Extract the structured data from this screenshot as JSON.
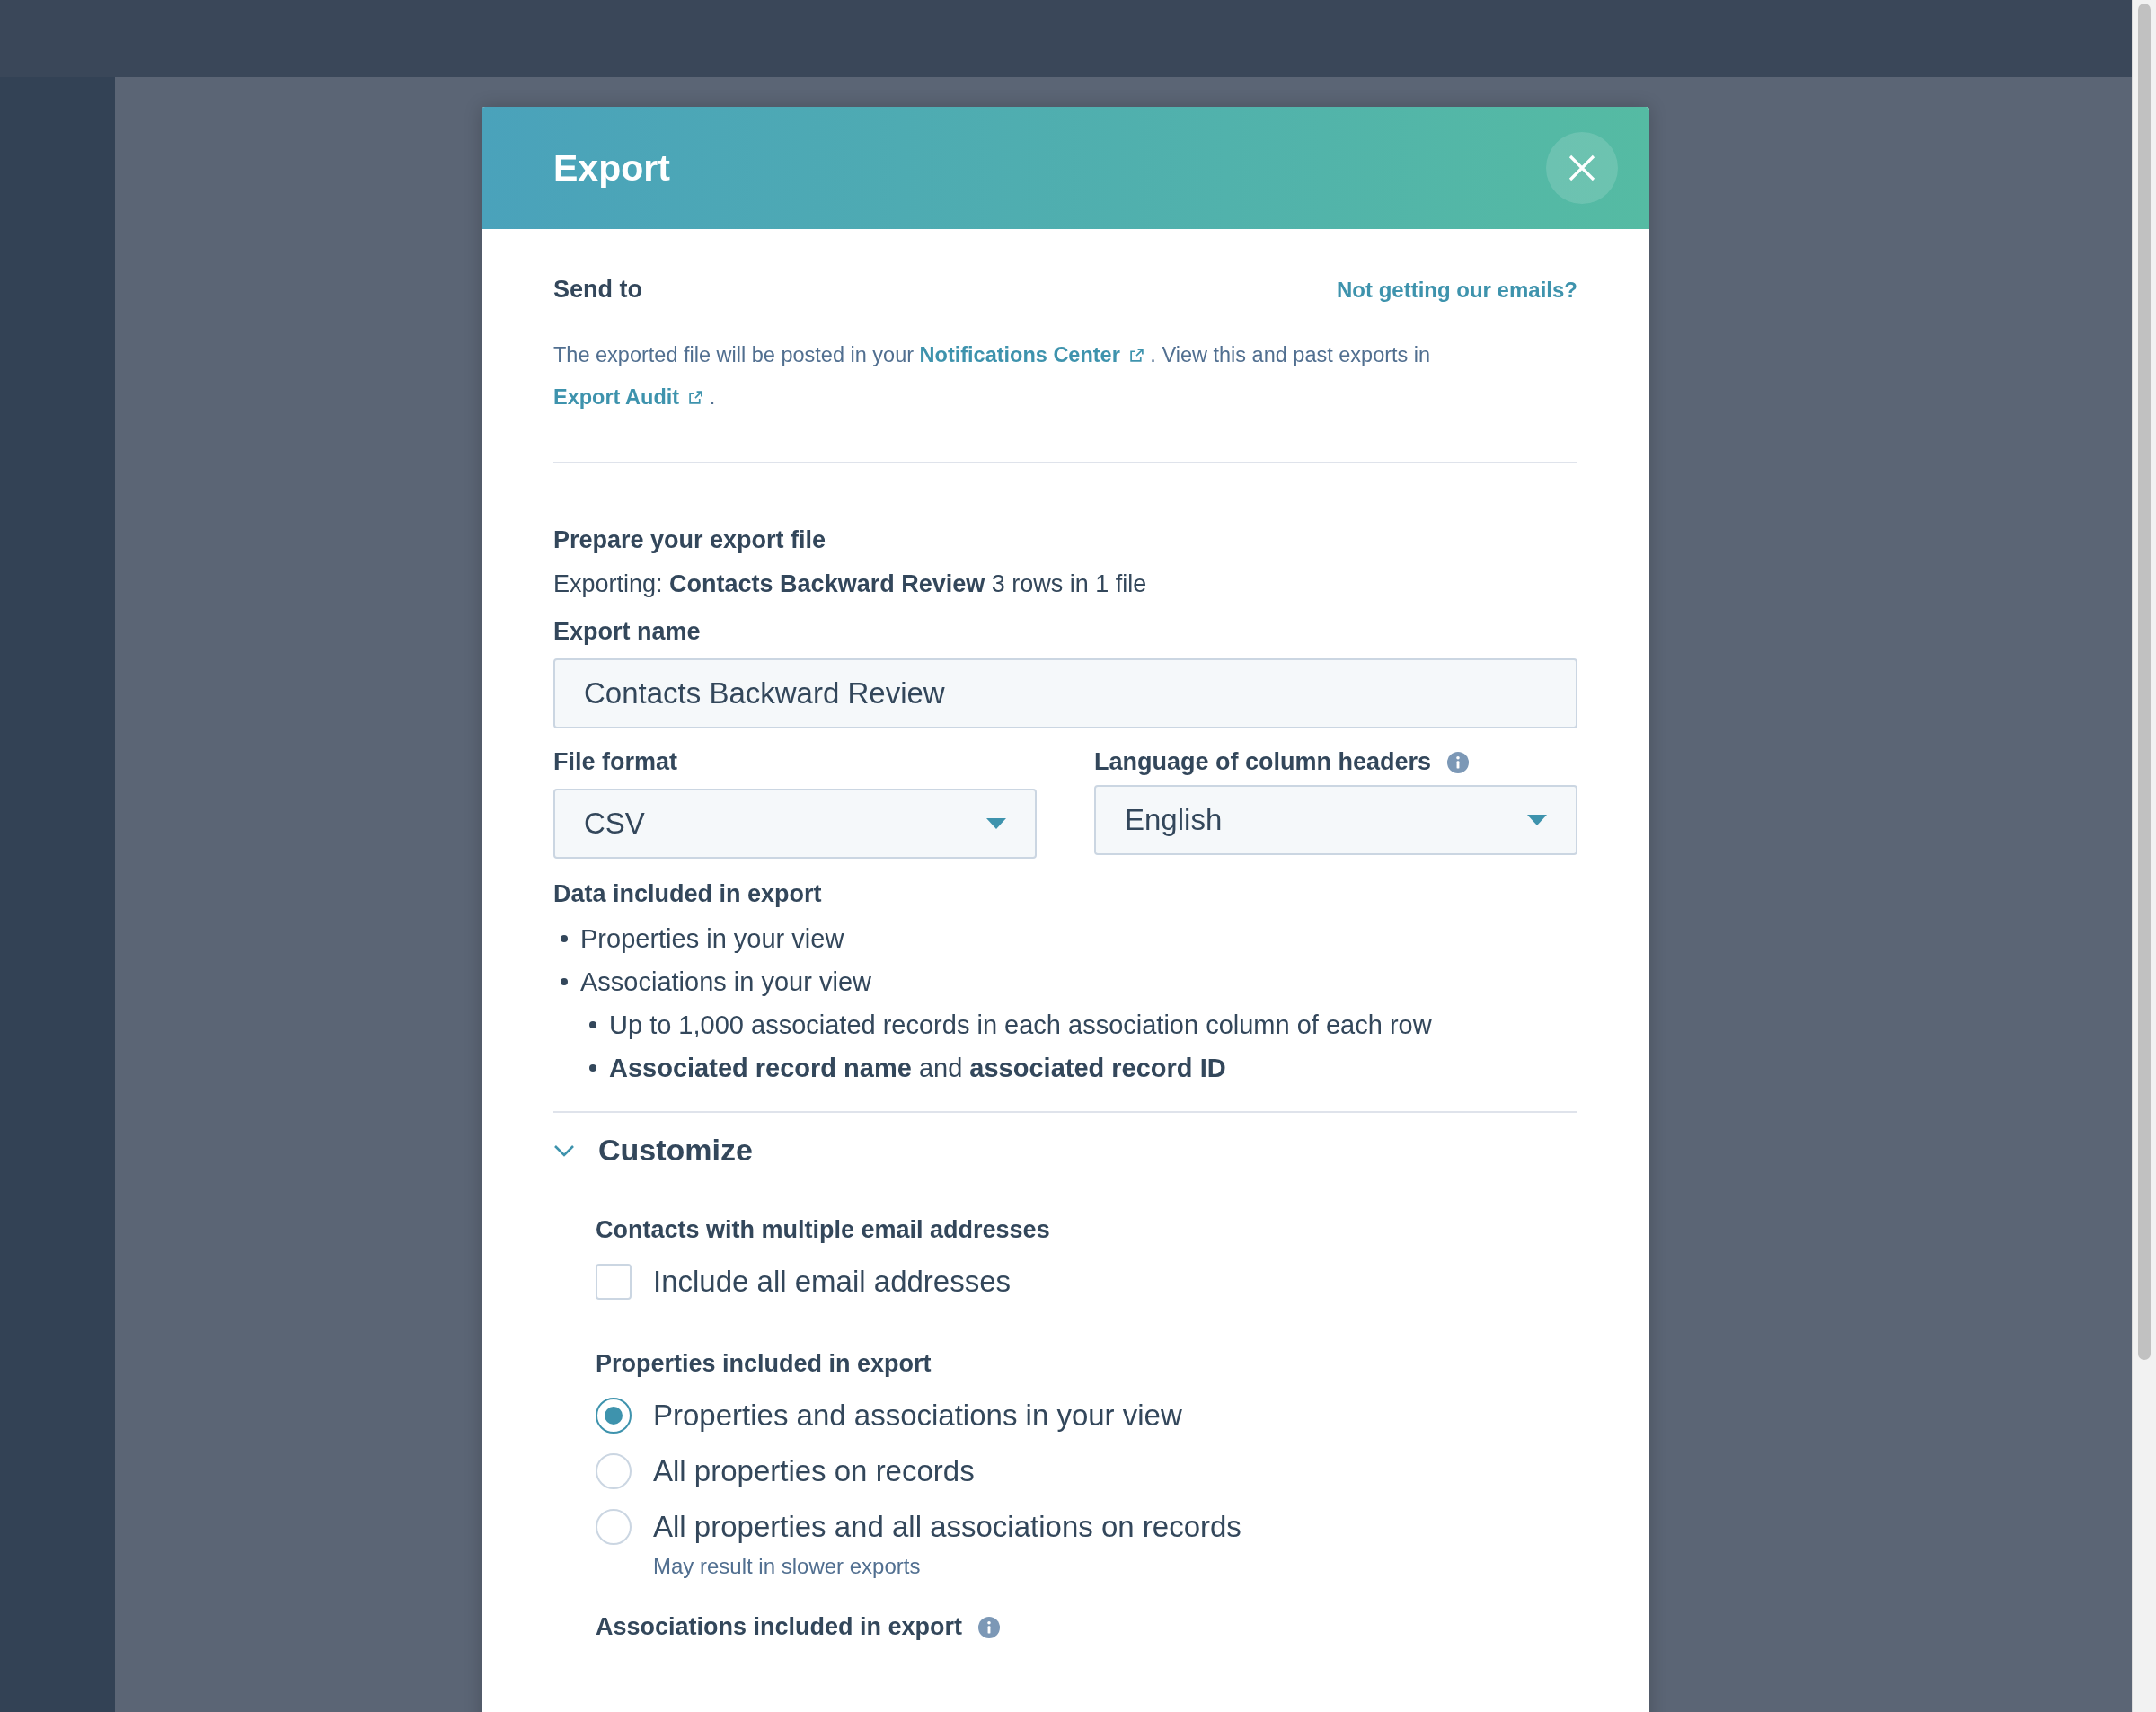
{
  "modal": {
    "title": "Export"
  },
  "send_to": {
    "heading": "Send to",
    "help_link": "Not getting our emails?",
    "description": [
      {
        "kind": "text",
        "text": "The exported file will be posted in your "
      },
      {
        "kind": "link",
        "text": "Notifications Center"
      },
      {
        "kind": "text",
        "text": " . View this and past exports in "
      },
      {
        "kind": "link",
        "text": "Export Audit"
      },
      {
        "kind": "text",
        "text": " ."
      }
    ]
  },
  "prepare": {
    "heading": "Prepare your export file",
    "summary": "Exporting: **Contacts Backward Review**  3 rows in 1 file"
  },
  "export_name": {
    "label": "Export name",
    "value": "Contacts Backward Review"
  },
  "file_format": {
    "label": "File format",
    "value": "CSV"
  },
  "language": {
    "label": "Language of column headers",
    "value": "English"
  },
  "data_included": {
    "heading": "Data included in export",
    "items": [
      {
        "text": "Properties in your view"
      },
      {
        "text": "Associations in your view",
        "children": [
          {
            "text": "Up to 1,000 associated records in each association column of each row"
          },
          {
            "text": "**Associated record name** and **associated record ID**"
          }
        ]
      }
    ]
  },
  "customize": {
    "title": "Customize",
    "expanded": true,
    "email_section": {
      "heading": "Contacts with multiple email addresses",
      "checkbox": {
        "label": "Include all email addresses",
        "checked": false
      }
    },
    "properties_section": {
      "heading": "Properties included in export",
      "options": [
        {
          "label": "Properties and associations in your view",
          "selected": true
        },
        {
          "label": "All properties on records",
          "selected": false
        },
        {
          "label": "All properties and all associations on records",
          "selected": false,
          "hint": "May result in slower exports"
        }
      ]
    },
    "associations_section": {
      "heading": "Associations included in export"
    }
  }
}
